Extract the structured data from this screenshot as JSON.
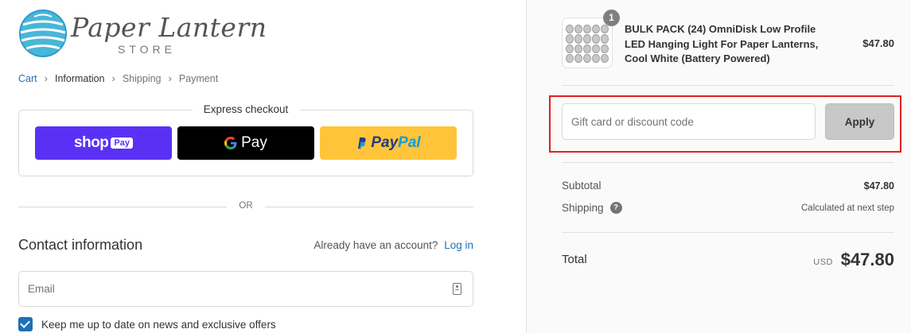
{
  "brand": {
    "name": "Paper Lantern",
    "subtitle": "STORE"
  },
  "breadcrumb": [
    {
      "label": "Cart",
      "state": "link"
    },
    {
      "label": "Information",
      "state": "current"
    },
    {
      "label": "Shipping",
      "state": "upcoming"
    },
    {
      "label": "Payment",
      "state": "upcoming"
    }
  ],
  "express_checkout": {
    "title": "Express checkout",
    "shop_pay": {
      "label": "shop",
      "badge": "Pay"
    },
    "google_pay": {
      "label": "Pay"
    },
    "paypal": {
      "part1": "Pay",
      "part2": "Pal"
    }
  },
  "divider_text": "OR",
  "contact": {
    "title": "Contact information",
    "account_prompt": "Already have an account?",
    "login_label": "Log in",
    "email_placeholder": "Email",
    "newsletter_label": "Keep me up to date on news and exclusive offers",
    "newsletter_checked": true
  },
  "order_summary": {
    "item": {
      "quantity": "1",
      "name": "BULK PACK (24) OmniDisk Low Profile LED Hanging Light For Paper Lanterns, Cool White (Battery Powered)",
      "price": "$47.80"
    },
    "discount": {
      "placeholder": "Gift card or discount code",
      "apply_label": "Apply"
    },
    "subtotal_label": "Subtotal",
    "subtotal_value": "$47.80",
    "shipping_label": "Shipping",
    "shipping_value": "Calculated at next step",
    "total_label": "Total",
    "currency": "USD",
    "total_value": "$47.80"
  },
  "colors": {
    "shop_pay": "#5a31f4",
    "google_pay": "#000000",
    "paypal": "#ffc439",
    "link": "#1f6fb5",
    "highlight": "#e02020",
    "apply_button": "#c8c8c8"
  },
  "icons": [
    "logo-globe-icon",
    "chevron-right-icon",
    "google-g-icon",
    "paypal-p-icon",
    "contact-card-icon",
    "checkbox-check-icon",
    "help-question-icon"
  ]
}
